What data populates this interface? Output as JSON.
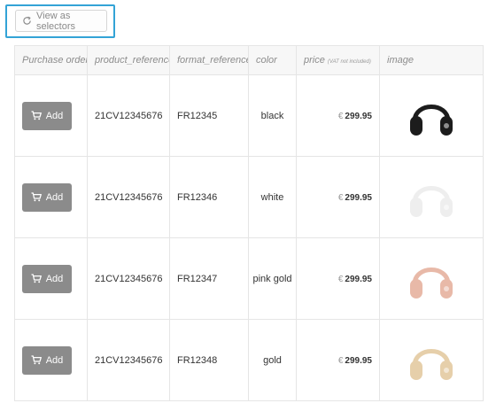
{
  "toolbar": {
    "view_as_selectors_label": "View as selectors",
    "view_as_selectors_icon": "refresh-icon"
  },
  "table": {
    "headers": {
      "purchase_order": "Purchase order",
      "product_reference": "product_reference",
      "format_reference": "format_reference",
      "color": "color",
      "price": "price",
      "price_note": "(VAT not included)",
      "image": "image"
    },
    "rows": [
      {
        "add_label": "Add",
        "product_reference": "21CV12345676",
        "format_reference": "FR12345",
        "color": "black",
        "currency": "€",
        "price": "299.95",
        "image_color": "#1c1c1c"
      },
      {
        "add_label": "Add",
        "product_reference": "21CV12345676",
        "format_reference": "FR12346",
        "color": "white",
        "currency": "€",
        "price": "299.95",
        "image_color": "#eeeeee"
      },
      {
        "add_label": "Add",
        "product_reference": "21CV12345676",
        "format_reference": "FR12347",
        "color": "pink gold",
        "currency": "€",
        "price": "299.95",
        "image_color": "#e8b9a8"
      },
      {
        "add_label": "Add",
        "product_reference": "21CV12345676",
        "format_reference": "FR12348",
        "color": "gold",
        "currency": "€",
        "price": "299.95",
        "image_color": "#e6cfaa"
      }
    ]
  },
  "colors": {
    "accent_frame": "#33a3d6",
    "add_button": "#8b8b8b"
  }
}
